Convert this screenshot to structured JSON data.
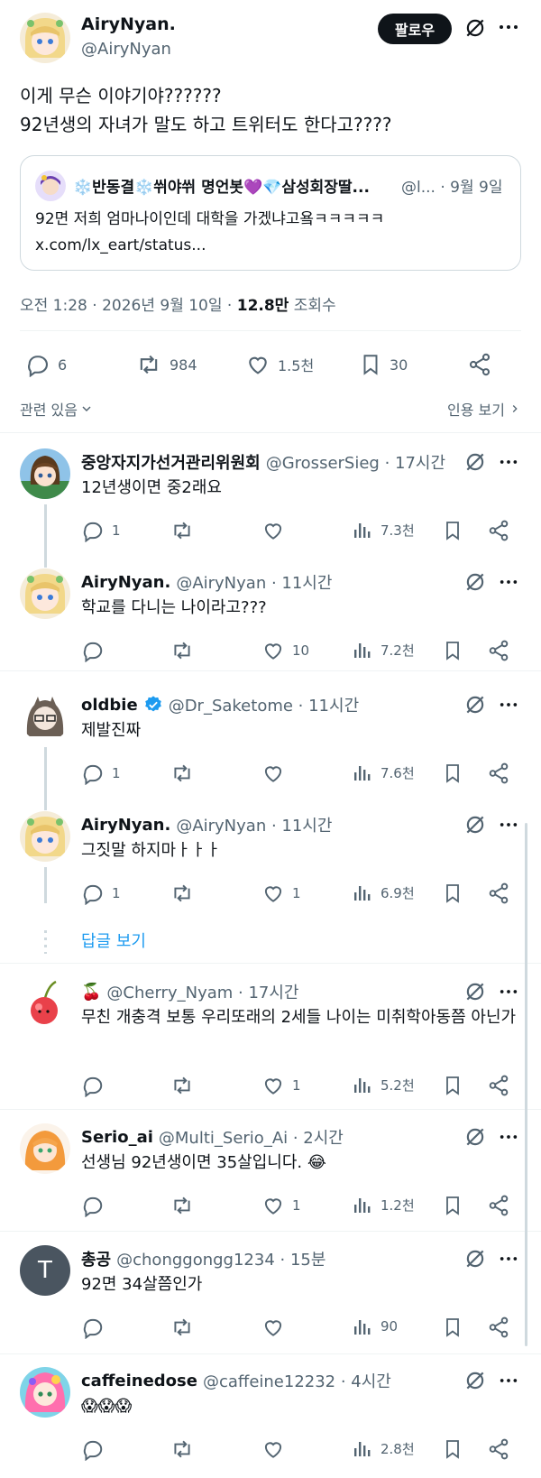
{
  "main_tweet": {
    "name": "AiryNyan.",
    "handle": "@AiryNyan",
    "follow_label": "팔로우",
    "text_line1": "이게 무슨 이야기야??????",
    "text_line2": "92년생의 자녀가 말도 하고 트위터도 한다고????",
    "quote": {
      "name": "❄️반동결❄️쒸야쒸 명언봇💜💎삼성회장딸...",
      "handle_time": "@l... · 9월 9일",
      "text_line1": "92면 저희 엄마나이인데 대학을 가겠냐고욬ㅋㅋㅋㅋㅋ",
      "text_line2": "x.com/lx_eart/status..."
    },
    "meta_time": "오전 1:28 · 2026년 9월 10일 · ",
    "meta_views": "12.8만",
    "meta_views_label": " 조회수",
    "stats": {
      "replies": "6",
      "reposts": "984",
      "likes": "1.5천",
      "bookmarks": "30"
    },
    "related_label": "관련 있음",
    "quotes_label": "인용 보기"
  },
  "replies": [
    {
      "name": "중앙자지가선거관리위원회",
      "handle_time": "@GrosserSieg · 17시간",
      "text": "12년생이면 중2래요",
      "reply_count": "1",
      "repost_count": "",
      "like_count": "",
      "views": "7.3천"
    },
    {
      "name": "AiryNyan.",
      "handle_time": "@AiryNyan · 11시간",
      "text": "학교를 다니는 나이라고???",
      "reply_count": "",
      "repost_count": "",
      "like_count": "10",
      "views": "7.2천"
    },
    {
      "name": "oldbie",
      "handle_time": "@Dr_Saketome · 11시간",
      "text": "제발진짜",
      "reply_count": "1",
      "repost_count": "",
      "like_count": "",
      "views": "7.6천"
    },
    {
      "name": "AiryNyan.",
      "handle_time": "@AiryNyan · 11시간",
      "text": "그짓말 하지마ㅏㅏㅏ",
      "reply_count": "1",
      "repost_count": "",
      "like_count": "1",
      "views": "6.9천"
    },
    {
      "name": "🍒",
      "handle_time": "@Cherry_Nyam · 17시간",
      "text": "무친 개충격 보통 우리또래의 2세들 나이는 미취학아동쯤 아닌가",
      "reply_count": "",
      "repost_count": "",
      "like_count": "1",
      "views": "5.2천"
    },
    {
      "name": "Serio_ai",
      "handle_time": "@Multi_Serio_Ai · 2시간",
      "text": "선생님 92년생이면 35살입니다. 😂",
      "reply_count": "",
      "repost_count": "",
      "like_count": "1",
      "views": "1.2천"
    },
    {
      "name": "총공",
      "handle_time": "@chonggongg1234 · 15분",
      "text": "92면 34살쯤인가",
      "reply_count": "",
      "repost_count": "",
      "like_count": "",
      "views": "90"
    },
    {
      "name": "caffeinedose",
      "handle_time": "@caffeine12232 · 4시간",
      "text": "😱😱😱",
      "reply_count": "",
      "repost_count": "",
      "like_count": "",
      "views": "2.8천"
    }
  ],
  "show_replies_label": "답글 보기",
  "avatar_letter_T": "T",
  "colors": {
    "accent": "#1d9bf0",
    "text": "#0f1419",
    "muted": "#536471",
    "verified": "#1d9bf0"
  }
}
